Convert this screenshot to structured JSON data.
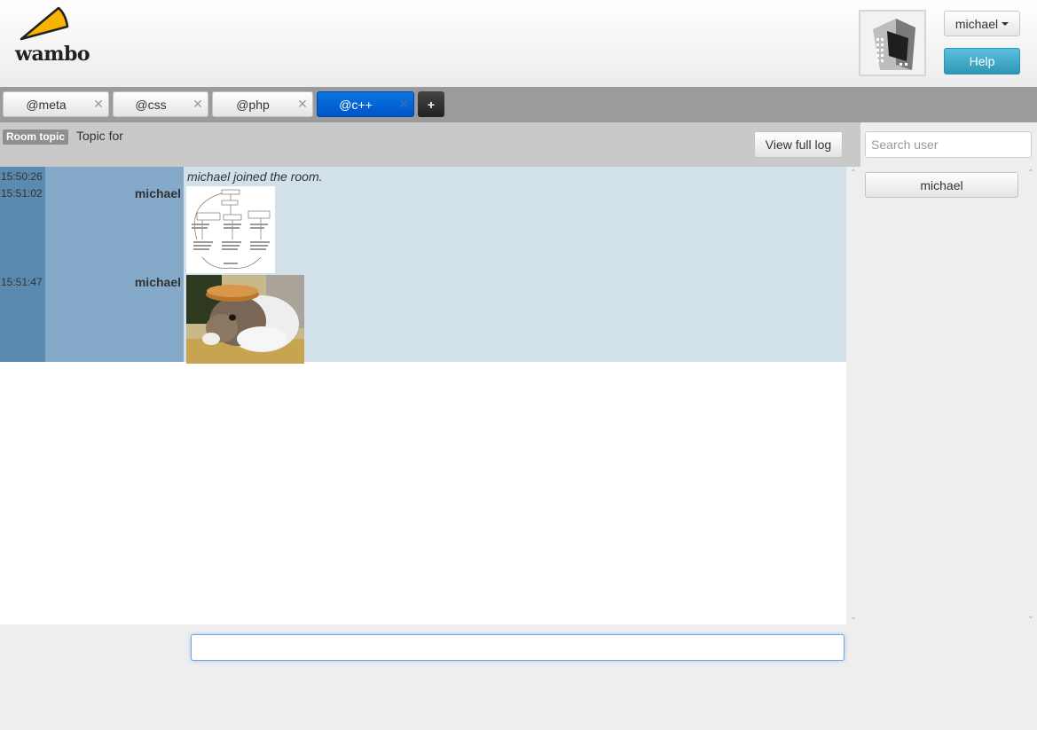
{
  "app": {
    "logo_text": "wambo"
  },
  "header": {
    "user_menu_label": "michael",
    "help_label": "Help"
  },
  "tabs": [
    {
      "label": "@meta",
      "close": "✕",
      "active": false
    },
    {
      "label": "@css",
      "close": "✕",
      "active": false
    },
    {
      "label": "@php",
      "close": "✕",
      "active": false
    },
    {
      "label": "@c++",
      "close": "✕",
      "active": true
    }
  ],
  "tab_add_label": "+",
  "topic": {
    "badge": "Room topic",
    "text": "Topic for",
    "view_log_label": "View full log"
  },
  "sidebar": {
    "search_placeholder": "Search user",
    "users": [
      "michael"
    ]
  },
  "messages": [
    {
      "time": "15:50:26",
      "nick": "",
      "text": "michael joined the room.",
      "type": "system"
    },
    {
      "time": "15:51:02",
      "nick": "michael",
      "text": "",
      "type": "image",
      "image": "flowchart-diagram"
    },
    {
      "time": "15:51:47",
      "nick": "michael",
      "text": "",
      "type": "image",
      "image": "rabbit-with-pancake-photo"
    }
  ],
  "colors": {
    "time_column": "#5b8ab0",
    "nick_column": "#84a9c9",
    "body_column": "#d2e0ea",
    "active_tab": "#0a77e0",
    "help_button": "#5bc0de",
    "logo_yellow": "#f7b500"
  },
  "chat_input": {
    "value": ""
  }
}
